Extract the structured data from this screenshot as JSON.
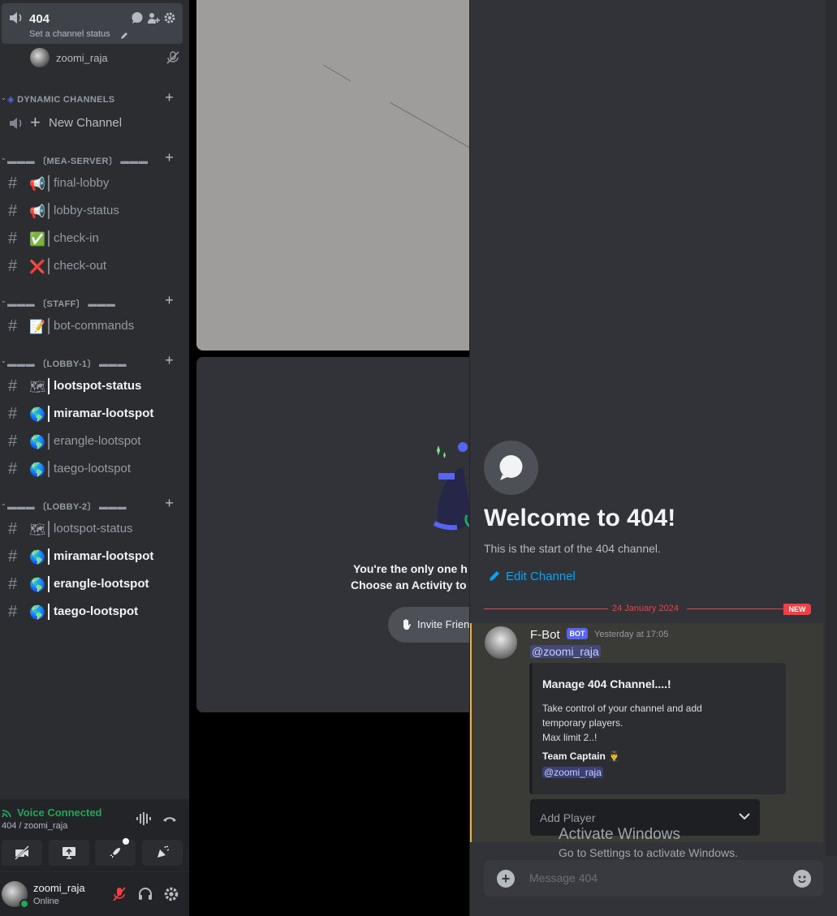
{
  "voice_channel": {
    "name": "404",
    "status_placeholder": "Set a channel status",
    "users": [
      {
        "name": "zoomi_raja"
      }
    ]
  },
  "categories": [
    {
      "label": "DYNAMIC CHANNELS",
      "channels": [
        {
          "name": "New Channel",
          "type": "voice"
        }
      ]
    },
    {
      "label": "▬▬▬ 〔MEA-SERVER〕 ▬▬▬",
      "channels": [
        {
          "name": "final-lobby",
          "emoji": "📢"
        },
        {
          "name": "lobby-status",
          "emoji": "📢"
        },
        {
          "name": "check-in",
          "emoji": "✅"
        },
        {
          "name": "check-out",
          "emoji": "❌"
        }
      ]
    },
    {
      "label": "▬▬▬ 〔STAFF〕 ▬▬▬",
      "channels": [
        {
          "name": "bot-commands",
          "emoji": "📝"
        }
      ]
    },
    {
      "label": "▬▬▬ 〔LOBBY-1〕 ▬▬▬",
      "channels": [
        {
          "name": "lootspot-status",
          "emoji": "🗺",
          "unread": true
        },
        {
          "name": "miramar-lootspot",
          "emoji": "🌎",
          "unread": true
        },
        {
          "name": "erangle-lootspot",
          "emoji": "🌎"
        },
        {
          "name": "taego-lootspot",
          "emoji": "🌎"
        }
      ]
    },
    {
      "label": "▬▬▬ 〔LOBBY-2〕 ▬▬▬",
      "channels": [
        {
          "name": "lootspot-status",
          "emoji": "🗺"
        },
        {
          "name": "miramar-lootspot",
          "emoji": "🌎",
          "unread": true
        },
        {
          "name": "erangle-lootspot",
          "emoji": "🌎",
          "unread": true
        },
        {
          "name": "taego-lootspot",
          "emoji": "🌎",
          "unread": true
        }
      ]
    }
  ],
  "voice_bar": {
    "status": "Voice Connected",
    "path": "404 / zoomi_raja"
  },
  "user": {
    "name": "zoomi_raja",
    "status": "Online"
  },
  "stage": {
    "line1": "You're the only one h",
    "line2": "Choose an Activity to",
    "invite_label": "Invite Frien"
  },
  "chat": {
    "welcome_title": "Welcome to 404!",
    "welcome_sub": "This is the start of the 404 channel.",
    "edit_channel": "Edit Channel",
    "date_divider": "24 January 2024",
    "new_badge": "NEW",
    "message": {
      "author": "F-Bot",
      "bot_tag": "BOT",
      "time": "Yesterday at 17:05",
      "mention": "@zoomi_raja",
      "embed": {
        "title": "Manage 404 Channel....!",
        "desc1": "Take control of your channel and add temporary players.",
        "desc2": "Max limit 2..!",
        "field_name": "Team Captain 👨‍✈️",
        "field_value": "@zoomi_raja"
      },
      "select_placeholder": "Add Player"
    },
    "composer_placeholder": "Message 404"
  },
  "watermark": {
    "line1": "Activate Windows",
    "line2": "Go to Settings to activate Windows."
  },
  "colors": {
    "accent": "#5865f2",
    "connected": "#23a55a",
    "new": "#f23f43",
    "link": "#00a8fc"
  }
}
